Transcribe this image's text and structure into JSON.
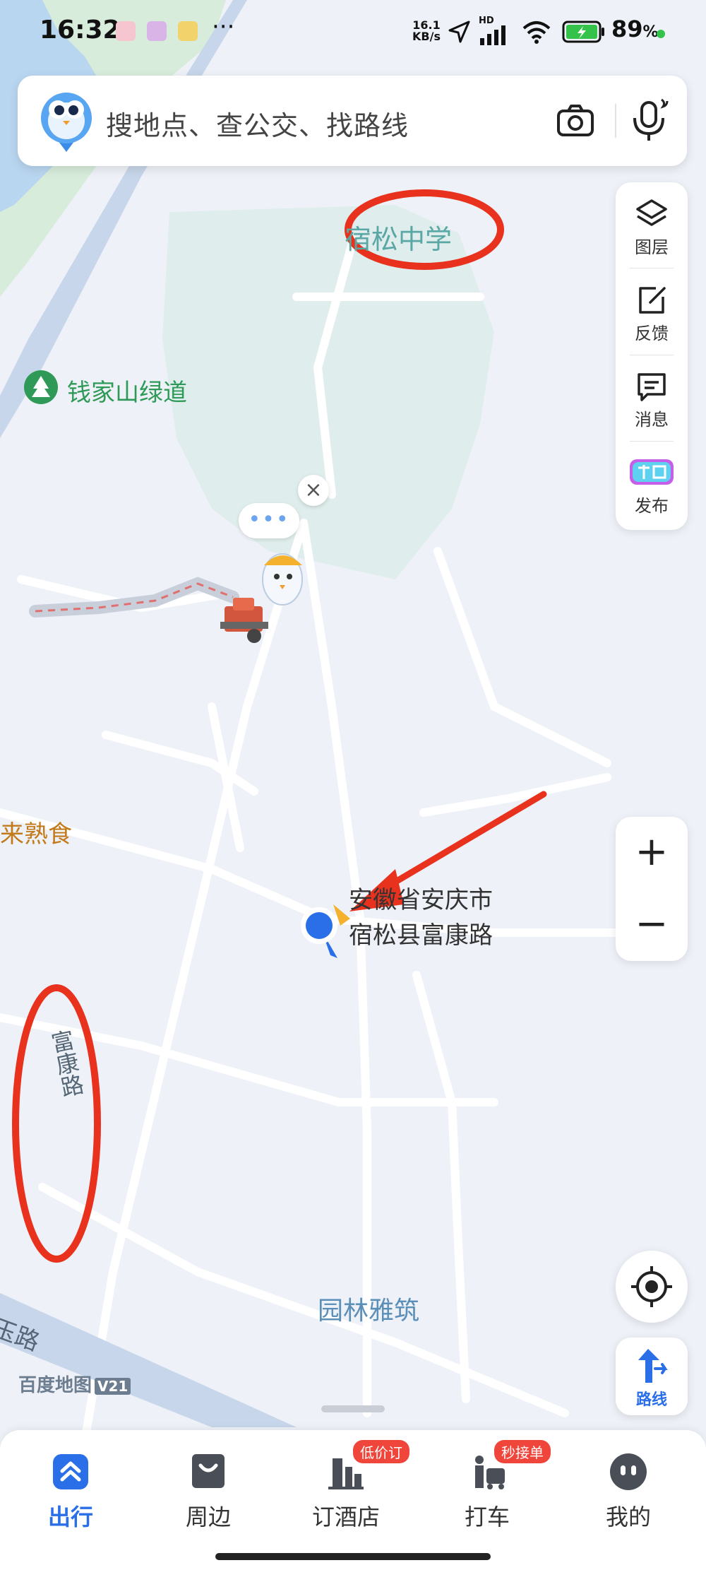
{
  "status_bar": {
    "time": "16:32",
    "network_speed_value": "16.1",
    "network_speed_unit": "KB/s",
    "hd_label": "HD",
    "battery": "89",
    "battery_unit": "%"
  },
  "search": {
    "placeholder": "搜地点、查公交、找路线"
  },
  "side_panel": {
    "items": [
      {
        "label": "图层",
        "icon": "layers-icon"
      },
      {
        "label": "反馈",
        "icon": "feedback-icon"
      },
      {
        "label": "消息",
        "icon": "message-icon"
      },
      {
        "label": "发布",
        "icon": "publish-icon"
      }
    ]
  },
  "zoom": {
    "in": "+",
    "out": "−"
  },
  "route_button": {
    "label": "路线"
  },
  "map": {
    "labels": {
      "school": "宿松中学",
      "greenway": "钱家山绿道",
      "shop": "来熟食",
      "address_line1": "安徽省安庆市",
      "address_line2": "宿松县富康路",
      "fukang_road": "富康路",
      "yuanlin": "园林雅筑",
      "yu_road": "玉路"
    },
    "watermark": "百度地图",
    "watermark_version": "V21",
    "close_bubble": "×",
    "dots_bubble": "•••"
  },
  "annotations_color": "#e8321e",
  "tabs": [
    {
      "label": "出行",
      "active": true
    },
    {
      "label": "周边",
      "active": false
    },
    {
      "label": "订酒店",
      "active": false,
      "badge": "低价订"
    },
    {
      "label": "打车",
      "active": false,
      "badge": "秒接单"
    },
    {
      "label": "我的",
      "active": false
    }
  ]
}
